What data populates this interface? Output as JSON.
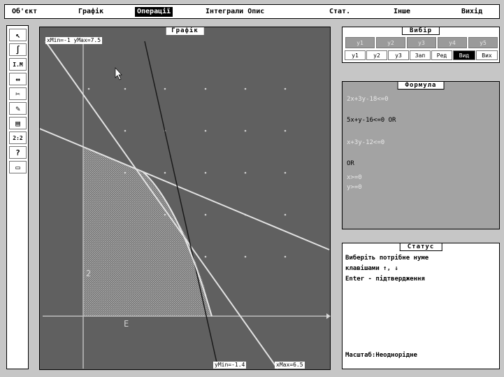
{
  "menu": [
    {
      "label": "Об'єкт",
      "active": false
    },
    {
      "label": "Графік",
      "active": false
    },
    {
      "label": "Операції",
      "active": true
    },
    {
      "label": "Інтеграли Опис",
      "active": false
    },
    {
      "label": "Стат.",
      "active": false
    },
    {
      "label": "Інше",
      "active": false
    },
    {
      "label": "Вихід",
      "active": false
    }
  ],
  "toolbar": [
    {
      "icon": "cursor-icon",
      "glyph": "↖"
    },
    {
      "icon": "integral-icon",
      "glyph": "∫"
    },
    {
      "icon": "interval-icon",
      "glyph": "I.M"
    },
    {
      "icon": "resize-icon",
      "glyph": "↔"
    },
    {
      "icon": "scissors-icon",
      "glyph": "✂"
    },
    {
      "icon": "brush-icon",
      "glyph": "✎"
    },
    {
      "icon": "fill-icon",
      "glyph": "▤"
    },
    {
      "icon": "ratio-icon",
      "glyph": "2:2"
    },
    {
      "icon": "help-icon",
      "glyph": "?"
    },
    {
      "icon": "window-icon",
      "glyph": "▭"
    }
  ],
  "graph": {
    "title": "Графік",
    "readout_top": "xMin=-1  yMax=7.5",
    "readout_bottom_left": "yMin=-1.4",
    "readout_bottom_right": "xMax=6.5"
  },
  "choice": {
    "title": "Вибір",
    "cells": [
      "y1",
      "y2",
      "y3",
      "y4",
      "y5"
    ],
    "modes": [
      "y1",
      "y2",
      "y3",
      "Зап",
      "Ред",
      "Вид",
      "Вих"
    ],
    "active_mode": "Вид"
  },
  "formula": {
    "title": "Формула",
    "lines": [
      {
        "text": "2x+3y-18<=0",
        "style": "dim"
      },
      {
        "text": "5x+y-16<=0 OR",
        "style": "dark"
      },
      {
        "text": "x+3y-12<=0",
        "style": "dim"
      },
      {
        "text": "OR",
        "style": "dark"
      },
      {
        "text": "x>=0",
        "style": "dim"
      },
      {
        "text": "y>=0",
        "style": "dim"
      }
    ]
  },
  "status": {
    "title": "Статус",
    "lines": [
      "Виберіть потрібне нуме",
      "клавішами ↑, ↓",
      "Enter - підтвердження"
    ],
    "footer": "Масштаб:Неоднорідне"
  }
}
